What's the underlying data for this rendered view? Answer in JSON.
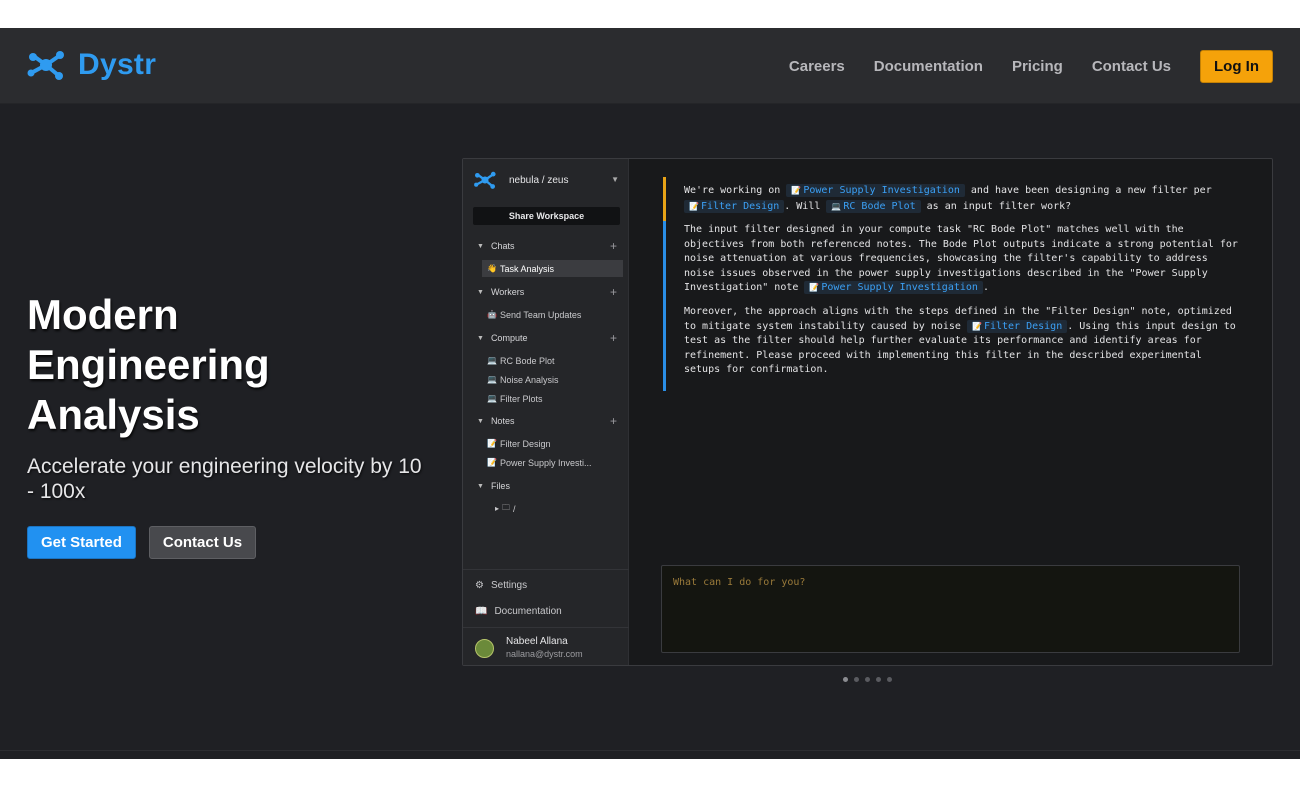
{
  "brand": {
    "name": "Dystr",
    "color": "#2f9bf0",
    "logo_icon": "molecule-icon"
  },
  "nav": {
    "links": [
      "Careers",
      "Documentation",
      "Pricing",
      "Contact Us"
    ],
    "login_label": "Log In",
    "login_color": "#f5a20a"
  },
  "hero": {
    "title_lines": [
      "Modern",
      "Engineering",
      "Analysis"
    ],
    "subtitle": "Accelerate your engineering velocity by 10 - 100x",
    "primary_label": "Get Started",
    "secondary_label": "Contact Us"
  },
  "app": {
    "workspace": "nebula / zeus",
    "share_label": "Share Workspace",
    "sections": {
      "chats": "Chats",
      "workers": "Workers",
      "compute": "Compute",
      "notes": "Notes",
      "files": "Files"
    },
    "chats": [
      "Task Analysis"
    ],
    "workers": [
      "Send Team Updates"
    ],
    "compute": [
      "RC Bode Plot",
      "Noise Analysis",
      "Filter Plots"
    ],
    "notes": [
      "Filter Design",
      "Power Supply Investi..."
    ],
    "files": [
      "/"
    ],
    "settings_label": "Settings",
    "docs_label": "Documentation",
    "user": {
      "name": "Nabeel Allana",
      "email": "nallana@dystr.com"
    },
    "messages": {
      "user_a": "We're working on",
      "tag_psi": "Power Supply Investigation",
      "user_b": "and have been designing a new filter per",
      "tag_fd": "Filter Design",
      "user_c": ". Will",
      "tag_rc": "RC Bode Plot",
      "user_d": "as an input filter work?",
      "bot_p1": "The input filter designed in your compute task \"RC Bode Plot\" matches well with the objectives from both referenced notes. The Bode Plot outputs indicate a strong potential for noise attenuation at various frequencies, showcasing the filter's capability to address noise issues observed in the power supply investigations described in the \"Power Supply Investigation\" note",
      "bot_p1_end": ".",
      "bot_p2a": "Moreover, the approach aligns with the steps defined in the \"Filter Design\" note, optimized to mitigate system instability caused by noise",
      "bot_p2b": ". Using this input design to test as the filter should help further evaluate its performance and identify areas for refinement. Please proceed with implementing this filter in the described experimental setups for confirmation."
    },
    "prompt_placeholder": "What can I do for you?"
  },
  "carousel": {
    "count": 5,
    "active_index": 0
  }
}
